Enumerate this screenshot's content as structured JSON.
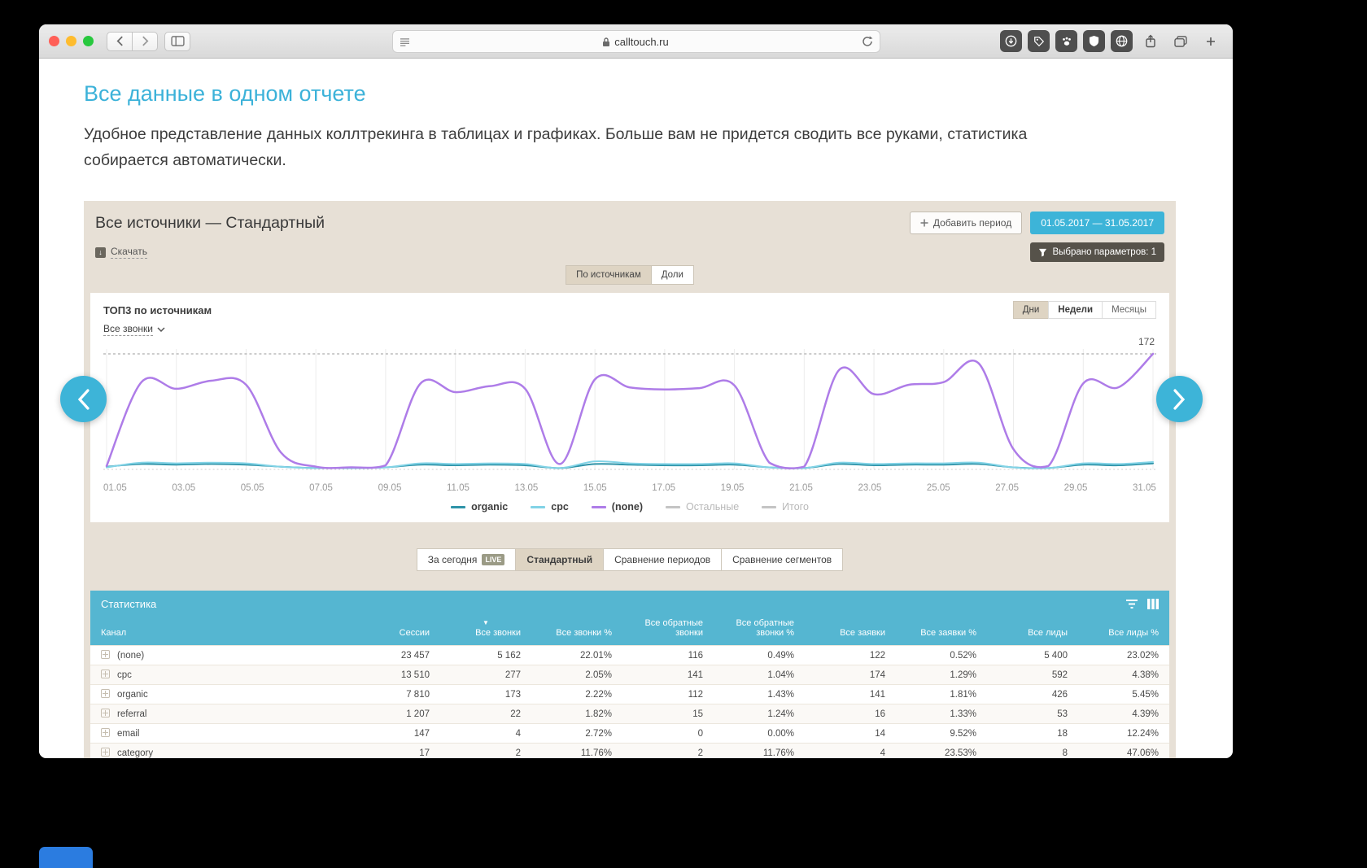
{
  "colors": {
    "accent": "#3db4d8",
    "heading": "#3cb2d9",
    "panel-bg": "#e7e0d6",
    "tan-active": "#ded4c3",
    "table-header": "#55b6d1",
    "dot-active": "#2ea7cb",
    "dot-inactive": "#c6e6f3"
  },
  "browser": {
    "url": "calltouch.ru"
  },
  "page": {
    "heading": "Все данные в одном отчете",
    "subtitle": "Удобное представление данных коллтрекинга в таблицах и графиках. Больше вам не придется сводить все руками, статистика собирается автоматически."
  },
  "report": {
    "title": "Все источники — Стандартный",
    "add_period": "Добавить период",
    "date_range": "01.05.2017 — 31.05.2017",
    "download": "Скачать",
    "params": "Выбрано параметров: 1",
    "view_toggle": [
      {
        "label": "По источникам",
        "active": true
      },
      {
        "label": "Доли",
        "active": false
      }
    ],
    "mode_tabs": [
      {
        "label": "За сегодня",
        "badge": "LIVE",
        "active": false
      },
      {
        "label": "Стандартный",
        "active": true
      },
      {
        "label": "Сравнение периодов",
        "active": false
      },
      {
        "label": "Сравнение сегментов",
        "active": false
      }
    ],
    "table": {
      "title": "Статистика",
      "sort_indicator": "▼",
      "sort_column_index": 2,
      "columns": [
        "Канал",
        "Сессии",
        "Все звонки",
        "Все звонки %",
        "Все обратные звонки",
        "Все обратные звонки %",
        "Все заявки",
        "Все заявки %",
        "Все лиды",
        "Все лиды %"
      ],
      "rows": [
        [
          "(none)",
          "23 457",
          "5 162",
          "22.01%",
          "116",
          "0.49%",
          "122",
          "0.52%",
          "5 400",
          "23.02%"
        ],
        [
          "cpc",
          "13 510",
          "277",
          "2.05%",
          "141",
          "1.04%",
          "174",
          "1.29%",
          "592",
          "4.38%"
        ],
        [
          "organic",
          "7 810",
          "173",
          "2.22%",
          "112",
          "1.43%",
          "141",
          "1.81%",
          "426",
          "5.45%"
        ],
        [
          "referral",
          "1 207",
          "22",
          "1.82%",
          "15",
          "1.24%",
          "16",
          "1.33%",
          "53",
          "4.39%"
        ],
        [
          "email",
          "147",
          "4",
          "2.72%",
          "0",
          "0.00%",
          "14",
          "9.52%",
          "18",
          "12.24%"
        ],
        [
          "category",
          "17",
          "2",
          "11.76%",
          "2",
          "11.76%",
          "4",
          "23.53%",
          "8",
          "47.06%"
        ]
      ]
    }
  },
  "pagination": {
    "count": 13,
    "active_index": 0
  },
  "chart_data": {
    "type": "line",
    "title": "ТОП3 по источникам",
    "metric": "Все звонки",
    "period_tabs": [
      {
        "label": "Дни",
        "active": true
      },
      {
        "label": "Недели",
        "active": false
      },
      {
        "label": "Месяцы",
        "active": false
      }
    ],
    "x_tick_labels": [
      "01.05",
      "03.05",
      "05.05",
      "07.05",
      "09.05",
      "11.05",
      "13.05",
      "15.05",
      "17.05",
      "19.05",
      "21.05",
      "23.05",
      "25.05",
      "27.05",
      "29.05",
      "31.05"
    ],
    "max_line_value": 172,
    "ylim": [
      0,
      180
    ],
    "legend_position": "bottom",
    "series": [
      {
        "name": "organic",
        "color": "#2e93a8",
        "disabled": false,
        "values": [
          4,
          8,
          7,
          8,
          7,
          4,
          2,
          2,
          3,
          7,
          6,
          7,
          6,
          2,
          8,
          7,
          6,
          6,
          7,
          3,
          2,
          8,
          6,
          7,
          7,
          8,
          3,
          2,
          7,
          6,
          9
        ]
      },
      {
        "name": "cpc",
        "color": "#82d3e6",
        "disabled": false,
        "values": [
          3,
          10,
          9,
          10,
          9,
          4,
          2,
          2,
          3,
          9,
          8,
          9,
          8,
          2,
          12,
          9,
          8,
          8,
          9,
          3,
          2,
          10,
          8,
          9,
          9,
          10,
          3,
          2,
          9,
          8,
          11
        ]
      },
      {
        "name": "(none)",
        "color": "#ae7ce8",
        "disabled": false,
        "values": [
          5,
          130,
          120,
          132,
          126,
          25,
          4,
          3,
          6,
          128,
          115,
          124,
          120,
          8,
          134,
          122,
          119,
          121,
          125,
          10,
          4,
          148,
          112,
          126,
          130,
          158,
          30,
          5,
          128,
          122,
          172
        ]
      },
      {
        "name": "Остальные",
        "color": "#c4c4c4",
        "disabled": true,
        "values": []
      },
      {
        "name": "Итого",
        "color": "#c4c4c4",
        "disabled": true,
        "values": []
      }
    ]
  }
}
